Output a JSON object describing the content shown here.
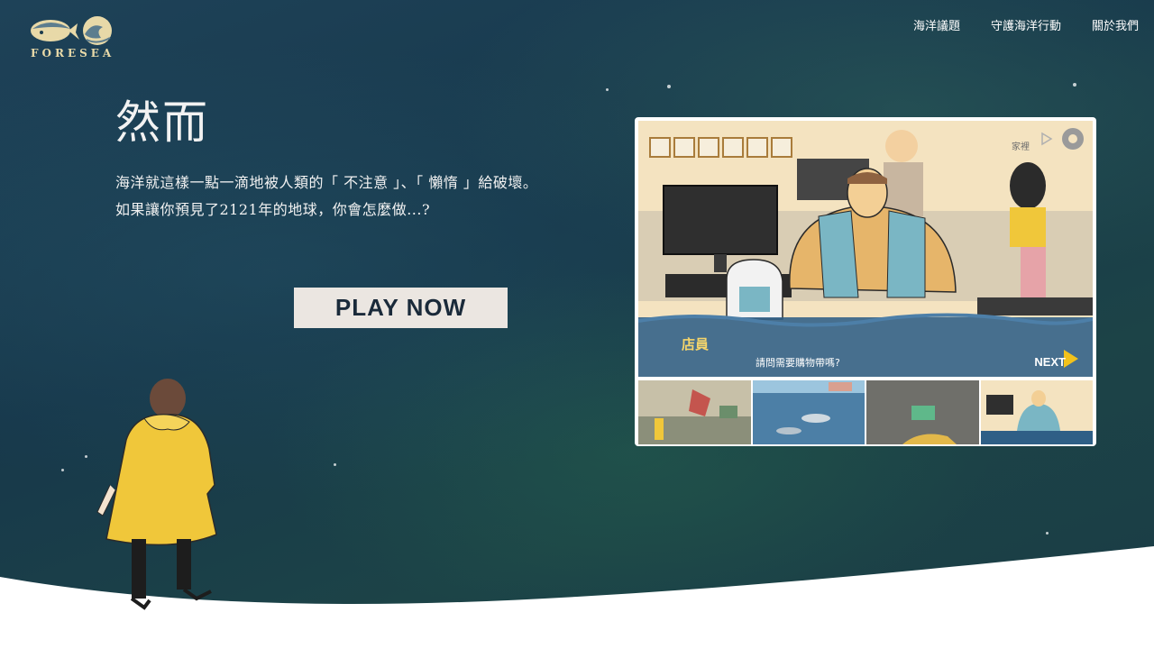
{
  "brand": {
    "logo_text": "FORESEA"
  },
  "nav": {
    "items": [
      {
        "label": "海洋議題"
      },
      {
        "label": "守護海洋行動"
      },
      {
        "label": "關於我們"
      }
    ]
  },
  "hero": {
    "title": "然而",
    "line1": "海洋就這樣一點一滴地被人類的「 不注意 」、「 懶惰 」給破壞。",
    "line2": "如果讓你預見了2121年的地球，你會怎麼做...?",
    "play_label": "PLAY NOW"
  },
  "game": {
    "scene_label": "家裡",
    "speaker": "店員",
    "dialog": "請問需要購物帶嗎?",
    "next_label": "NEXT",
    "inventory_slots": 6
  },
  "colors": {
    "ocean": "#1b3a4c",
    "button_bg": "#ebe6e1",
    "accent_yellow": "#f2c21b"
  }
}
